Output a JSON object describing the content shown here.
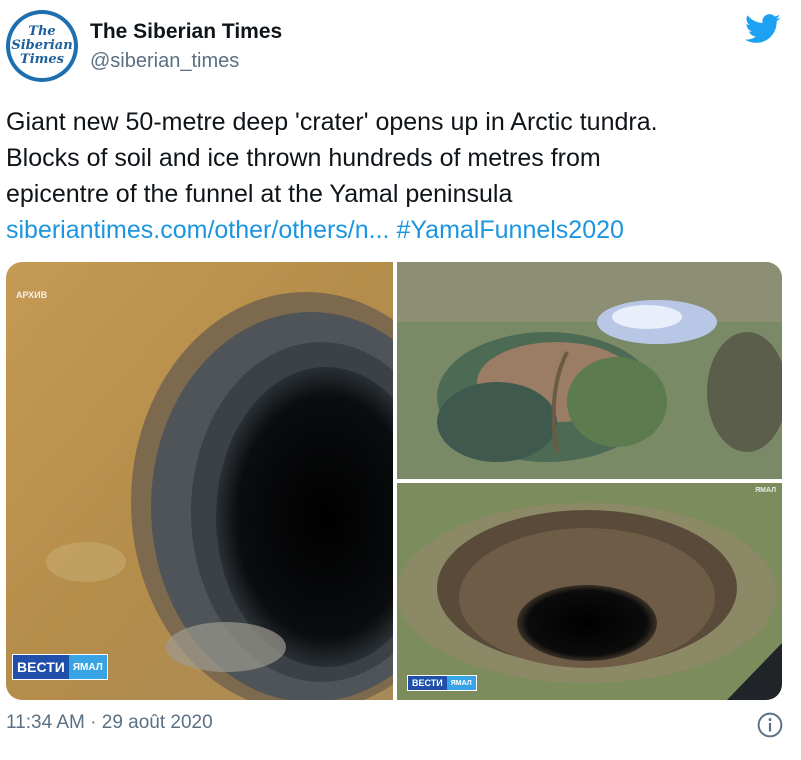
{
  "author": {
    "avatar_lines": [
      "The",
      "Siberian",
      "Times"
    ],
    "name": "The Siberian Times",
    "handle": "@siberian_times"
  },
  "tweet": {
    "line1": "Giant new 50-metre deep 'crater' opens up in Arctic tundra.",
    "line2": "Blocks of soil and ice thrown hundreds of metres from",
    "line3": "epicentre of the funnel at the Yamal peninsula",
    "link": "siberiantimes.com/other/others/n...",
    "hashtag": "#YamalFunnels2020"
  },
  "media": {
    "photo1": {
      "watermark": "АРХИВ",
      "logo_main": "ВЕСТИ",
      "logo_sub": "ЯМАЛ"
    },
    "photo2": {},
    "photo3": {
      "watermark": "ЯМАЛ",
      "logo_main": "ВЕСТИ",
      "logo_sub": "ЯМАЛ"
    }
  },
  "footer": {
    "timestamp": "11:34 AM · 29 août 2020"
  },
  "colors": {
    "link": "#1b95e0",
    "muted": "#5b7083",
    "twitter_blue": "#1da1f2"
  },
  "icons": {
    "brand": "twitter-bird-icon",
    "info": "info-icon"
  }
}
